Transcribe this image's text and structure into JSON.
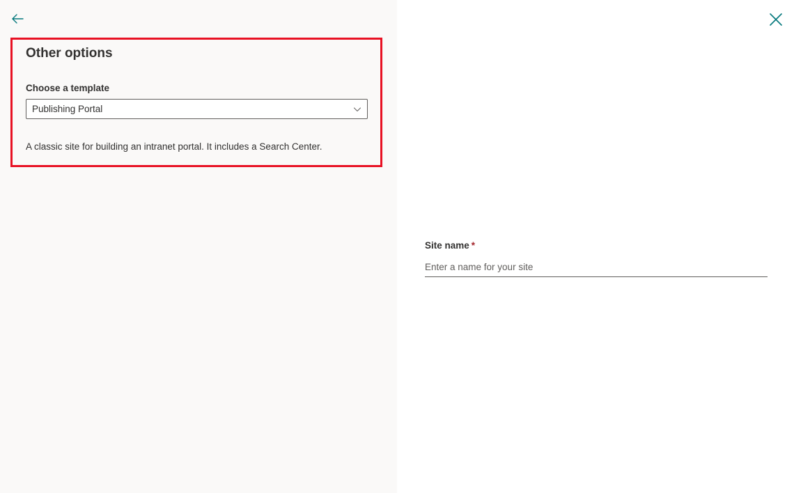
{
  "left_panel": {
    "title": "Other options",
    "template_label": "Choose a template",
    "template_selected": "Publishing Portal",
    "template_description": "A classic site for building an intranet portal. It includes a Search Center."
  },
  "right_panel": {
    "site_name_label": "Site name",
    "required_marker": "*",
    "site_name_placeholder": "Enter a name for your site",
    "site_name_value": ""
  },
  "icons": {
    "back": "back-arrow-icon",
    "close": "close-icon",
    "chevron": "chevron-down-icon"
  },
  "colors": {
    "accent": "#03787c",
    "highlight": "#e81123",
    "required": "#a4262c",
    "left_bg": "#faf9f8"
  }
}
